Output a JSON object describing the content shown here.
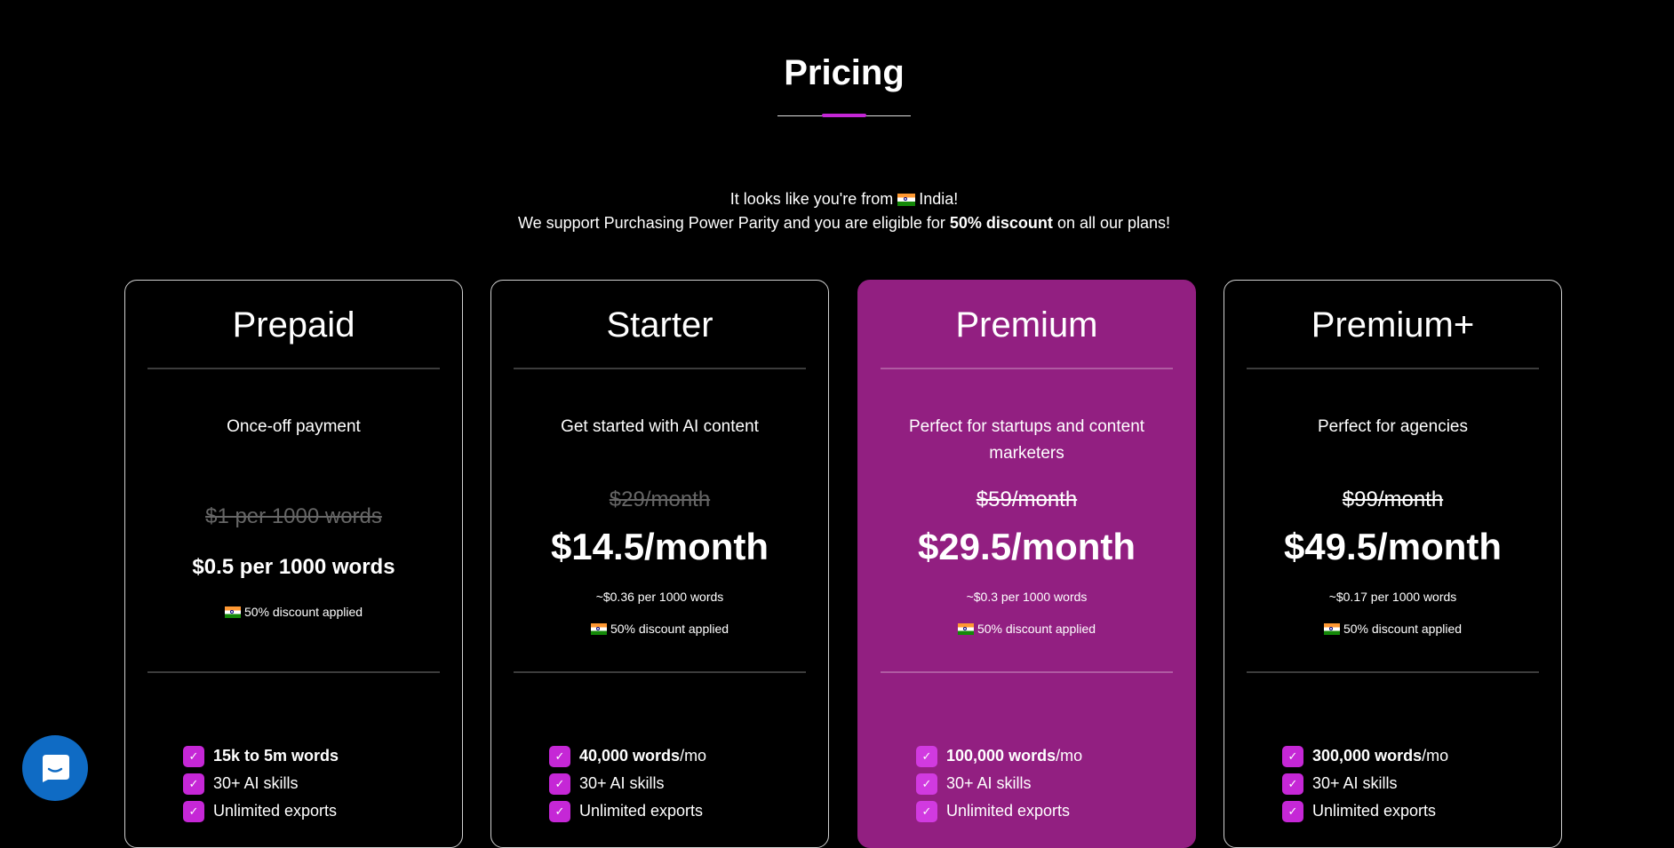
{
  "page": {
    "title": "Pricing"
  },
  "ppp": {
    "line1_prefix": "It looks like you're from",
    "country": "India!",
    "line2_prefix": "We support Purchasing Power Parity and you are eligible for",
    "line2_bold": "50% discount",
    "line2_suffix": "on all our plans!"
  },
  "plans": [
    {
      "name": "Prepaid",
      "tagline": "Once-off payment",
      "old_price": "$1 per 1000 words",
      "new_price": "$0.5 per 1000 words",
      "per_words": "",
      "discount": "50% discount applied",
      "features": [
        {
          "bold": "15k to 5m words",
          "rest": ""
        },
        {
          "bold": "",
          "rest": "30+ AI skills"
        },
        {
          "bold": "",
          "rest": "Unlimited exports"
        }
      ]
    },
    {
      "name": "Starter",
      "tagline": "Get started with AI content",
      "old_price": "$29/month",
      "new_price": "$14.5/month",
      "per_words": "~$0.36 per 1000 words",
      "discount": "50% discount applied",
      "features": [
        {
          "bold": "40,000 words",
          "rest": "/mo"
        },
        {
          "bold": "",
          "rest": "30+ AI skills"
        },
        {
          "bold": "",
          "rest": "Unlimited exports"
        }
      ]
    },
    {
      "name": "Premium",
      "tagline": "Perfect for startups and content marketers",
      "old_price": "$59/month",
      "new_price": "$29.5/month",
      "per_words": "~$0.3 per 1000 words",
      "discount": "50% discount applied",
      "features": [
        {
          "bold": "100,000 words",
          "rest": "/mo"
        },
        {
          "bold": "",
          "rest": "30+ AI skills"
        },
        {
          "bold": "",
          "rest": "Unlimited exports"
        }
      ]
    },
    {
      "name": "Premium+",
      "tagline": "Perfect for agencies",
      "old_price": "$99/month",
      "new_price": "$49.5/month",
      "per_words": "~$0.17 per 1000 words",
      "discount": "50% discount applied",
      "features": [
        {
          "bold": "300,000 words",
          "rest": "/mo"
        },
        {
          "bold": "",
          "rest": "30+ AI skills"
        },
        {
          "bold": "",
          "rest": "Unlimited exports"
        }
      ]
    }
  ],
  "colors": {
    "accent": "#c527d6",
    "featured_card": "#921f81",
    "chat_button": "#0f6bc4"
  },
  "icons": {
    "check": "check-icon",
    "chat": "chat-icon",
    "flag": "india-flag-icon"
  }
}
